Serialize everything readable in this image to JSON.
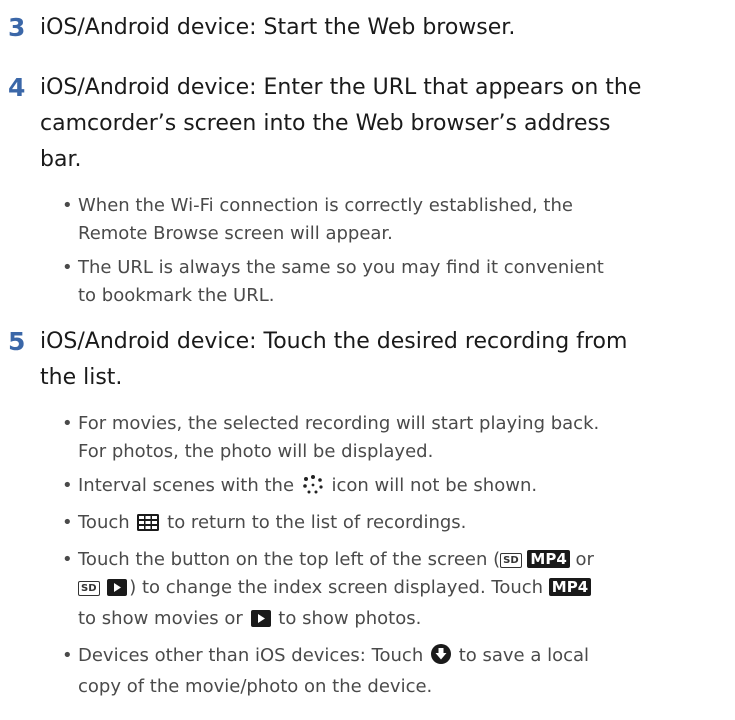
{
  "steps": [
    {
      "number": "3",
      "heading": "iOS/Android device: Start the Web browser."
    },
    {
      "number": "4",
      "heading_lines": [
        "iOS/Android device: Enter the URL that appears on the",
        "camcorder’s screen into the Web browser’s address",
        "bar."
      ],
      "bullets": [
        [
          "When the Wi-Fi connection is correctly established, the",
          "Remote Browse screen will appear."
        ],
        [
          "The URL is always the same so you may find it convenient",
          "to bookmark the URL."
        ]
      ]
    },
    {
      "number": "5",
      "heading_lines": [
        "iOS/Android device: Touch the desired recording from",
        "the list."
      ],
      "bullets": {
        "b1_l1": "For movies, the selected recording will start playing back.",
        "b1_l2": "For photos, the photo will be displayed.",
        "b2_a": "Interval scenes with the",
        "b2_b": "icon will not be shown.",
        "b3_a": "Touch",
        "b3_b": "to return to the list of recordings.",
        "b4_a": "Touch the button on the top left of the screen (",
        "b4_or": "or",
        "b4_b": ") to change the index screen displayed. Touch",
        "b4_c": "to show movies or",
        "b4_d": "to show photos.",
        "b5_a": "Devices other than iOS devices: Touch",
        "b5_b": "to save a local",
        "b5_c": "copy of the movie/photo on the device."
      }
    }
  ],
  "badges": {
    "sd": "SD",
    "mp4": "MP4"
  },
  "icons": {
    "interval": "interval-dots-icon",
    "index": "grid-index-icon",
    "photo": "photo-play-icon",
    "download": "download-arrow-icon"
  },
  "colors": {
    "step_number": "#3b67a8",
    "heading": "#1a1a1a",
    "bullet_text": "#4a4a4a"
  }
}
